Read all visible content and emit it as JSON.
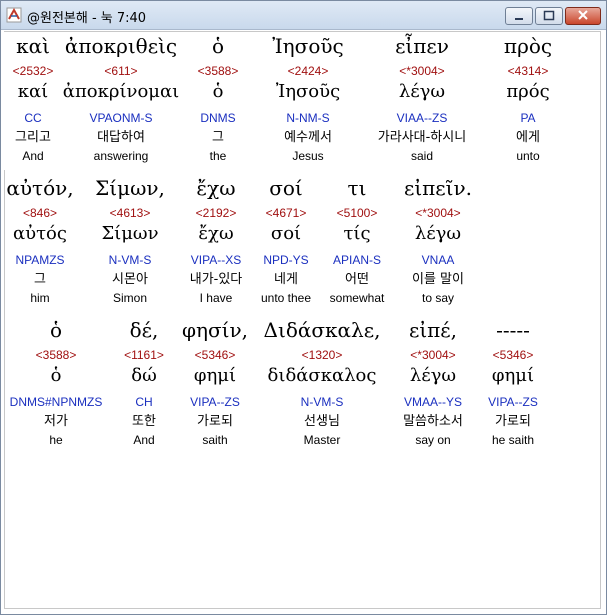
{
  "window": {
    "title": "@원전본해 - 눅 7:40"
  },
  "colors": {
    "strongs": "#a01010",
    "parsing": "#1a2fbf",
    "text": "#000000"
  },
  "icons": {
    "app": "app-logo-icon",
    "minimize": "minimize-icon",
    "maximize": "maximize-icon",
    "close": "close-icon"
  },
  "rows": [
    [
      {
        "greek": "καὶ",
        "strongs": "<2532>",
        "lemma": "καί",
        "parsing": "CC",
        "korean": "그리고",
        "english": "And"
      },
      {
        "greek": "ἀποκριθεὶς",
        "strongs": "<611>",
        "lemma": "ἀποκρίνομαι",
        "parsing": "VPAONM-S",
        "korean": "대답하여",
        "english": "answering"
      },
      {
        "greek": "ὁ",
        "strongs": "<3588>",
        "lemma": "ὁ",
        "parsing": "DNMS",
        "korean": "그",
        "english": "the"
      },
      {
        "greek": "Ἰησοῦς",
        "strongs": "<2424>",
        "lemma": "Ἰησοῦς",
        "parsing": "N-NM-S",
        "korean": "예수께서",
        "english": "Jesus"
      },
      {
        "greek": "εἶπεν",
        "strongs": "<*3004>",
        "lemma": "λέγω",
        "parsing": "VIAA--ZS",
        "korean": "가라사대-하시니",
        "english": "said"
      },
      {
        "greek": "πρὸς",
        "strongs": "<4314>",
        "lemma": "πρός",
        "parsing": "PA",
        "korean": "에게",
        "english": "unto"
      }
    ],
    [
      {
        "greek": "αὐτόν,",
        "strongs": "<846>",
        "lemma": "αὐτός",
        "parsing": "NPAMZS",
        "korean": "그",
        "english": "him"
      },
      {
        "greek": "Σίμων,",
        "strongs": "<4613>",
        "lemma": "Σίμων",
        "parsing": "N-VM-S",
        "korean": "시몬아",
        "english": "Simon"
      },
      {
        "greek": "ἔχω",
        "strongs": "<2192>",
        "lemma": "ἔχω",
        "parsing": "VIPA--XS",
        "korean": "내가-있다",
        "english": "I have"
      },
      {
        "greek": "σοί",
        "strongs": "<4671>",
        "lemma": "σοί",
        "parsing": "NPD-YS",
        "korean": "네게",
        "english": "unto thee"
      },
      {
        "greek": "τι",
        "strongs": "<5100>",
        "lemma": "τίς",
        "parsing": "APIAN-S",
        "korean": "어떤",
        "english": "somewhat"
      },
      {
        "greek": "εἰπεῖν.",
        "strongs": "<*3004>",
        "lemma": "λέγω",
        "parsing": "VNAA",
        "korean": "이를 말이",
        "english": "to say"
      }
    ],
    [
      {
        "greek": "ὁ",
        "strongs": "<3588>",
        "lemma": "ὁ",
        "parsing": "DNMS#NPNMZS",
        "korean": "저가",
        "english": "he"
      },
      {
        "greek": "δέ,",
        "strongs": "<1161>",
        "lemma": "δώ",
        "parsing": "CH",
        "korean": "또한",
        "english": "And"
      },
      {
        "greek": "φησίν,",
        "strongs": "<5346>",
        "lemma": "φημί",
        "parsing": "VIPA--ZS",
        "korean": "가로되",
        "english": "saith"
      },
      {
        "greek": "Διδάσκαλε,",
        "strongs": "<1320>",
        "lemma": "διδάσκαλος",
        "parsing": "N-VM-S",
        "korean": "선생님",
        "english": "Master"
      },
      {
        "greek": "εἰπέ,",
        "strongs": "<*3004>",
        "lemma": "λέγω",
        "parsing": "VMAA--YS",
        "korean": "말씀하소서",
        "english": "say on"
      },
      {
        "greek": "-----",
        "strongs": "<5346>",
        "lemma": "φημί",
        "parsing": "VIPA--ZS",
        "korean": "가로되",
        "english": "he saith"
      }
    ]
  ]
}
